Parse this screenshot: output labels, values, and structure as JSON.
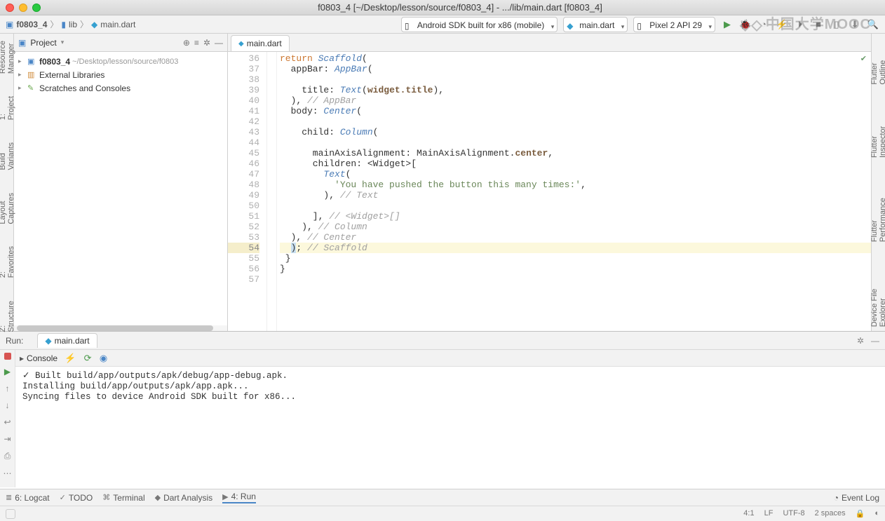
{
  "window": {
    "title": "f0803_4 [~/Desktop/lesson/source/f0803_4] - .../lib/main.dart [f0803_4]"
  },
  "breadcrumbs": {
    "project": "f0803_4",
    "folder": "lib",
    "file": "main.dart"
  },
  "toolbar": {
    "device": "Android SDK built for x86 (mobile)",
    "run_config": "main.dart",
    "emulator": "Pixel 2 API 29"
  },
  "watermark": "中国大学MOOC",
  "left_rail": [
    "Resource Manager",
    "1: Project",
    "Build Variants",
    "Layout Captures",
    "2: Favorites",
    "Z: Structure"
  ],
  "right_rail": [
    "Flutter Outline",
    "Flutter Inspector",
    "Flutter Performance",
    "Device File Explorer"
  ],
  "project_panel": {
    "title": "Project",
    "tree": [
      {
        "name": "f0803_4",
        "path": "~/Desktop/lesson/source/f0803",
        "icon": "folder",
        "indent": 0
      },
      {
        "name": "External Libraries",
        "path": "",
        "icon": "lib",
        "indent": 0
      },
      {
        "name": "Scratches and Consoles",
        "path": "",
        "icon": "scratch",
        "indent": 0
      }
    ]
  },
  "editor": {
    "tab": "main.dart",
    "first_line_no": 36,
    "highlight_line": 54,
    "lines": [
      {
        "html": "<span class='kw'>return</span> <span class='cls'>Scaffold</span>("
      },
      {
        "html": "  appBar: <span class='cls'>AppBar</span>("
      },
      {
        "html": ""
      },
      {
        "html": "    title: <span class='cls'>Text</span>(<span class='prop bold'>widget.title</span>),"
      },
      {
        "html": "  ), <span class='cmt'>// AppBar</span>"
      },
      {
        "html": "  body: <span class='cls'>Center</span>("
      },
      {
        "html": ""
      },
      {
        "html": "    child: <span class='cls'>Column</span>("
      },
      {
        "html": ""
      },
      {
        "html": "      mainAxisAlignment: MainAxisAlignment.<span class='prop bold'>center</span>,"
      },
      {
        "html": "      children: &lt;Widget&gt;["
      },
      {
        "html": "        <span class='cls'>Text</span>("
      },
      {
        "html": "          <span class='str'>'You have pushed the button this many times:'</span>,"
      },
      {
        "html": "        ), <span class='cmt'>// Text</span>"
      },
      {
        "html": ""
      },
      {
        "html": "      ], <span class='cmt'>// &lt;Widget&gt;[]</span>"
      },
      {
        "html": "    ), <span class='cmt'>// Column</span>"
      },
      {
        "html": "  ), <span class='cmt'>// Center</span>"
      },
      {
        "html": "  <span style='background:#c8dff0'>)</span>; <span class='cmt'>// Scaffold</span>"
      },
      {
        "html": " }"
      },
      {
        "html": "}"
      },
      {
        "html": ""
      }
    ]
  },
  "run_panel": {
    "title": "Run:",
    "tab": "main.dart",
    "console_label": "Console",
    "output": "✓ Built build/app/outputs/apk/debug/app-debug.apk.\nInstalling build/app/outputs/apk/app.apk...\nSyncing files to device Android SDK built for x86..."
  },
  "bottom_strip": {
    "items": [
      "6: Logcat",
      "TODO",
      "Terminal",
      "Dart Analysis",
      "4: Run"
    ],
    "active": "4: Run",
    "event_log": "Event Log"
  },
  "status": {
    "pos": "4:1",
    "lf": "LF",
    "enc": "UTF-8",
    "indent": "2 spaces"
  }
}
